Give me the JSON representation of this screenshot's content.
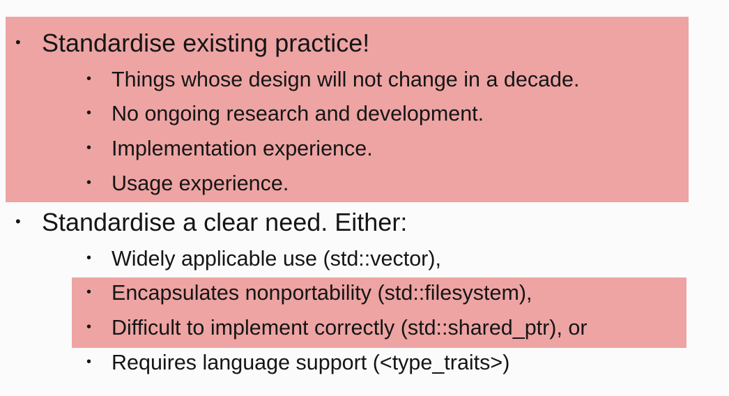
{
  "slide": {
    "bullet_glyph": "•",
    "highlight_color": "#eda4a3",
    "items": [
      {
        "text": "Standardise existing practice!",
        "highlighted": true,
        "subitems": [
          "Things whose design will not change in a decade.",
          "No ongoing research and development.",
          "Implementation experience.",
          "Usage experience."
        ]
      },
      {
        "text": "Standardise a clear need. Either:",
        "highlighted": false,
        "subitems": [
          "Widely applicable use (std::vector),",
          "Encapsulates nonportability (std::filesystem),",
          "Difficult to implement correctly (std::shared_ptr), or",
          "Requires language support (<type_traits>)"
        ],
        "highlighted_subitems": [
          1,
          2
        ]
      }
    ]
  }
}
